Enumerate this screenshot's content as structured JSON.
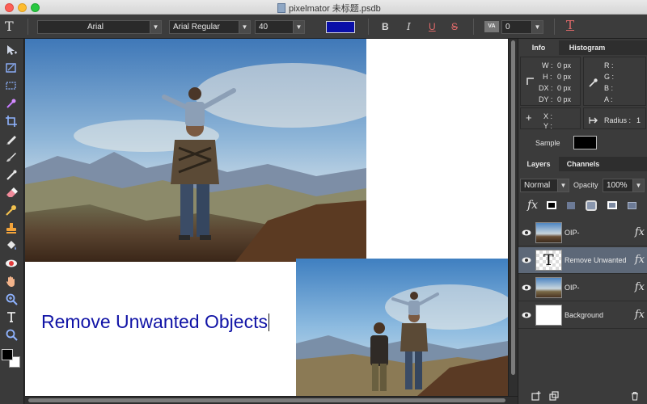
{
  "window": {
    "title": "pixelmator 未标题.psdb"
  },
  "options_bar": {
    "font_family": "Arial",
    "font_style": "Arial Regular",
    "font_size": "40",
    "text_color": "#0a0fa8",
    "bold": "B",
    "italic": "I",
    "underline": "U",
    "strikethrough": "S",
    "tracking_icon": "VA",
    "tracking_value": "0",
    "tool_glyph": "T",
    "clear_format_glyph": "T"
  },
  "tools": [
    {
      "name": "move-tool-icon"
    },
    {
      "name": "transform-tool-icon"
    },
    {
      "name": "marquee-tool-icon"
    },
    {
      "name": "magic-wand-tool-icon"
    },
    {
      "name": "crop-tool-icon"
    },
    {
      "name": "pencil-tool-icon"
    },
    {
      "name": "brush-tool-icon"
    },
    {
      "name": "smudge-tool-icon"
    },
    {
      "name": "eraser-tool-icon"
    },
    {
      "name": "eyedropper-tool-icon"
    },
    {
      "name": "stamp-tool-icon"
    },
    {
      "name": "paint-bucket-tool-icon"
    },
    {
      "name": "red-eye-tool-icon"
    },
    {
      "name": "hand-tool-icon"
    },
    {
      "name": "zoom-tool-icon"
    },
    {
      "name": "type-tool-icon"
    },
    {
      "name": "search-tool-icon"
    }
  ],
  "canvas": {
    "text_layer_content": "Remove Unwanted Objects"
  },
  "info_panel": {
    "tabs": [
      "Info",
      "Histogram"
    ],
    "w_label": "W :",
    "w_value": "0 px",
    "h_label": "H :",
    "h_value": "0 px",
    "dx_label": "DX :",
    "dx_value": "0 px",
    "dy_label": "DY :",
    "dy_value": "0 px",
    "r_label": "R :",
    "g_label": "G :",
    "b_label": "B :",
    "a_label": "A :",
    "x_label": "X :",
    "y_label": "Y :",
    "radius_label": "Radius :",
    "radius_value": "1",
    "sample_label": "Sample",
    "sample_color": "#000000"
  },
  "layers_panel": {
    "tabs": [
      "Layers",
      "Channels"
    ],
    "blend_mode": "Normal",
    "opacity_label": "Opacity",
    "opacity_value": "100%",
    "fx_label": "fx",
    "layers": [
      {
        "name": "OIP-",
        "type": "image",
        "selected": false
      },
      {
        "name": "Remove Unwanted",
        "type": "text",
        "selected": true
      },
      {
        "name": "OIP-",
        "type": "image",
        "selected": false
      },
      {
        "name": "Background",
        "type": "fill",
        "selected": false
      }
    ]
  }
}
